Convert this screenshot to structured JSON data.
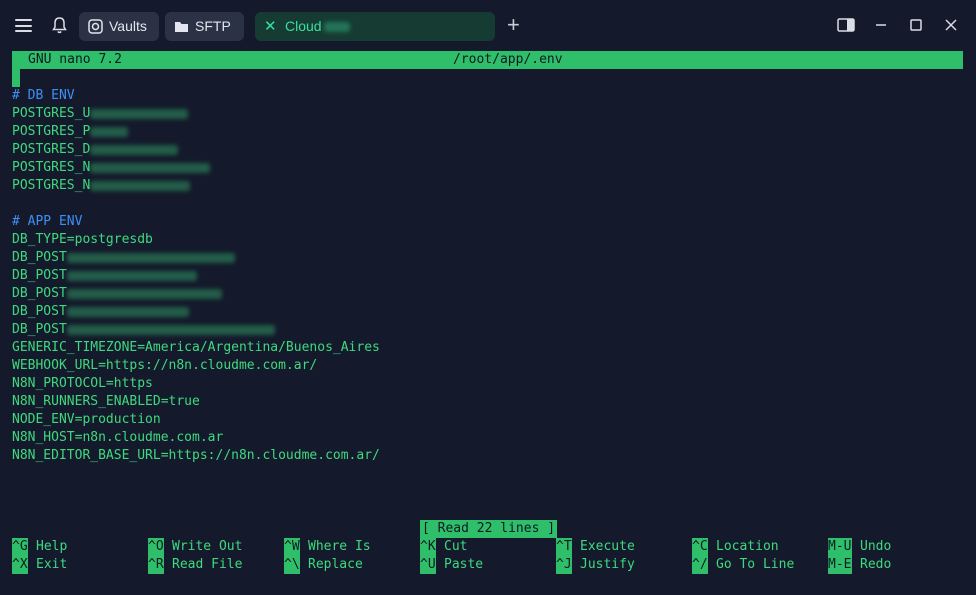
{
  "tabbar": {
    "tabs": [
      {
        "label": "Vaults",
        "icon": "vault-icon"
      },
      {
        "label": "SFTP",
        "icon": "folder-icon"
      },
      {
        "label": "Cloud",
        "icon": "close-icon"
      }
    ]
  },
  "nano": {
    "version": "GNU nano 7.2",
    "filename": "/root/app/.env",
    "status": "[ Read 22 lines ]"
  },
  "file_lines": [
    {
      "text": "# DB ENV",
      "kind": "comment"
    },
    {
      "text": "POSTGRES_U",
      "kind": "redacted"
    },
    {
      "text": "POSTGRES_P",
      "kind": "redacted"
    },
    {
      "text": "POSTGRES_D",
      "kind": "redacted"
    },
    {
      "text": "POSTGRES_N",
      "kind": "redacted"
    },
    {
      "text": "POSTGRES_N",
      "kind": "redacted"
    },
    {
      "text": "",
      "kind": "blank"
    },
    {
      "text": "# APP ENV",
      "kind": "comment"
    },
    {
      "text": "DB_TYPE=postgresdb",
      "kind": "plain"
    },
    {
      "text": "DB_POST",
      "kind": "redacted"
    },
    {
      "text": "DB_POST",
      "kind": "redacted"
    },
    {
      "text": "DB_POST",
      "kind": "redacted"
    },
    {
      "text": "DB_POST",
      "kind": "redacted"
    },
    {
      "text": "DB_POST",
      "kind": "redacted"
    },
    {
      "text": "GENERIC_TIMEZONE=America/Argentina/Buenos_Aires",
      "kind": "plain"
    },
    {
      "text": "WEBHOOK_URL=https://n8n.cloudme.com.ar/",
      "kind": "plain"
    },
    {
      "text": "N8N_PROTOCOL=https",
      "kind": "plain"
    },
    {
      "text": "N8N_RUNNERS_ENABLED=true",
      "kind": "plain"
    },
    {
      "text": "NODE_ENV=production",
      "kind": "plain"
    },
    {
      "text": "N8N_HOST=n8n.cloudme.com.ar",
      "kind": "plain"
    },
    {
      "text": "N8N_EDITOR_BASE_URL=https://n8n.cloudme.com.ar/",
      "kind": "plain"
    }
  ],
  "shortcuts": [
    [
      {
        "key": "^G",
        "label": "Help"
      },
      {
        "key": "^X",
        "label": "Exit"
      }
    ],
    [
      {
        "key": "^O",
        "label": "Write Out"
      },
      {
        "key": "^R",
        "label": "Read File"
      }
    ],
    [
      {
        "key": "^W",
        "label": "Where Is"
      },
      {
        "key": "^\\",
        "label": "Replace"
      }
    ],
    [
      {
        "key": "^K",
        "label": "Cut"
      },
      {
        "key": "^U",
        "label": "Paste"
      }
    ],
    [
      {
        "key": "^T",
        "label": "Execute"
      },
      {
        "key": "^J",
        "label": "Justify"
      }
    ],
    [
      {
        "key": "^C",
        "label": "Location"
      },
      {
        "key": "^/",
        "label": "Go To Line"
      }
    ],
    [
      {
        "key": "M-U",
        "label": "Undo"
      },
      {
        "key": "M-E",
        "label": "Redo"
      }
    ]
  ],
  "colors": {
    "background": "#141a2b",
    "accent": "#2fbf6a",
    "text": "#3ed97f",
    "comment": "#3f8ff5"
  }
}
